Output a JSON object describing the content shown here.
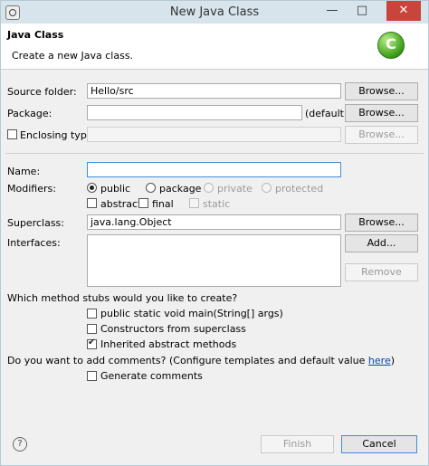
{
  "window": {
    "title": "New Java Class",
    "minimize": "—",
    "maximize": "□",
    "close": "✕"
  },
  "header": {
    "title": "Java Class",
    "description": "Create a new Java class.",
    "logo_text": "C"
  },
  "source_folder": {
    "label": "Source folder:",
    "value": "Hello/src",
    "browse": "Browse..."
  },
  "package": {
    "label": "Package:",
    "value": "",
    "default_text": "(default)",
    "browse": "Browse..."
  },
  "enclosing_type": {
    "label": "Enclosing type:",
    "checked": false,
    "value": "",
    "browse": "Browse..."
  },
  "name": {
    "label": "Name:",
    "value": ""
  },
  "modifiers": {
    "label": "Modifiers:",
    "radios": [
      {
        "label": "public",
        "selected": true,
        "enabled": true
      },
      {
        "label": "package",
        "selected": false,
        "enabled": true
      },
      {
        "label": "private",
        "selected": false,
        "enabled": false
      },
      {
        "label": "protected",
        "selected": false,
        "enabled": false
      }
    ],
    "checks": [
      {
        "label": "abstract",
        "checked": false,
        "enabled": true
      },
      {
        "label": "final",
        "checked": false,
        "enabled": true
      },
      {
        "label": "static",
        "checked": false,
        "enabled": false
      }
    ]
  },
  "superclass": {
    "label": "Superclass:",
    "value": "java.lang.Object",
    "browse": "Browse..."
  },
  "interfaces": {
    "label": "Interfaces:",
    "add": "Add...",
    "remove": "Remove"
  },
  "stubs": {
    "question": "Which method stubs would you like to create?",
    "options": [
      {
        "label": "public static void main(String[] args)",
        "checked": false
      },
      {
        "label": "Constructors from superclass",
        "checked": false
      },
      {
        "label": "Inherited abstract methods",
        "checked": true
      }
    ]
  },
  "comments": {
    "question": "Do you want to add comments? (Configure templates and default value ",
    "link": "here",
    "question_end": ")",
    "option": {
      "label": "Generate comments",
      "checked": false
    }
  },
  "footer": {
    "help": "?",
    "finish": "Finish",
    "cancel": "Cancel"
  }
}
